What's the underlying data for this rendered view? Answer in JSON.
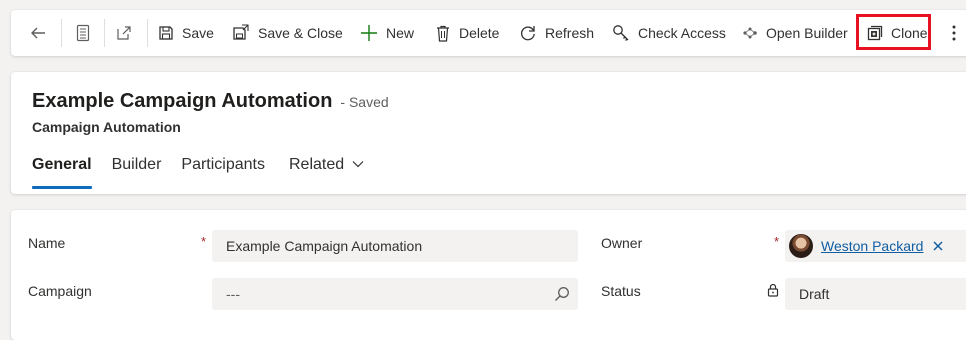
{
  "toolbar": {
    "back_label": "Back",
    "save_label": "Save",
    "save_close_label": "Save & Close",
    "new_label": "New",
    "delete_label": "Delete",
    "refresh_label": "Refresh",
    "check_access_label": "Check Access",
    "open_builder_label": "Open Builder",
    "clone_label": "Clone",
    "more_label": "More commands"
  },
  "header": {
    "title": "Example Campaign Automation",
    "saved_state": "- Saved",
    "entity": "Campaign Automation"
  },
  "tabs": [
    {
      "label": "General",
      "active": true
    },
    {
      "label": "Builder",
      "active": false
    },
    {
      "label": "Participants",
      "active": false
    },
    {
      "label": "Related",
      "active": false
    }
  ],
  "form": {
    "name_label": "Name",
    "name_value": "Example Campaign Automation",
    "campaign_label": "Campaign",
    "campaign_value": "---",
    "owner_label": "Owner",
    "owner_value": "Weston Packard",
    "status_label": "Status",
    "status_value": "Draft",
    "required_marker": "*"
  },
  "colors": {
    "accent": "#0f6cbd",
    "highlight": "#e81123",
    "required": "#a4262c",
    "link": "#115ea3"
  }
}
